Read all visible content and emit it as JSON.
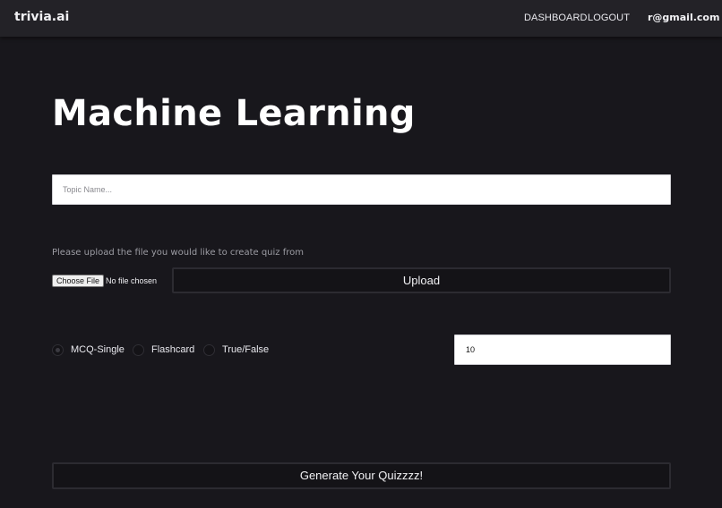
{
  "header": {
    "brand": "trivia.ai",
    "nav": {
      "dashboard": "DASHBOARD",
      "logout": "LOGOUT"
    },
    "user_email": "r@gmail.com"
  },
  "main": {
    "title": "Machine Learning",
    "topic_input": {
      "placeholder": "Topic Name...",
      "value": ""
    },
    "upload_hint": "Please upload the file you would like to create quiz from",
    "file_picker": {
      "button_label": "Choose File",
      "status": "No file chosen"
    },
    "upload_button": "Upload",
    "quiz_types": [
      {
        "label": "MCQ-Single",
        "checked": true
      },
      {
        "label": "Flashcard",
        "checked": false
      },
      {
        "label": "True/False",
        "checked": false
      }
    ],
    "question_count": "10",
    "generate_button": "Generate Your Quizzzz!"
  },
  "colors": {
    "page_bg": "#18171c",
    "navbar_bg": "#232227",
    "button_bg": "#141317",
    "button_border": "#2c2b31",
    "text": "#e9e9ee",
    "muted_text": "#9c9ca3"
  }
}
